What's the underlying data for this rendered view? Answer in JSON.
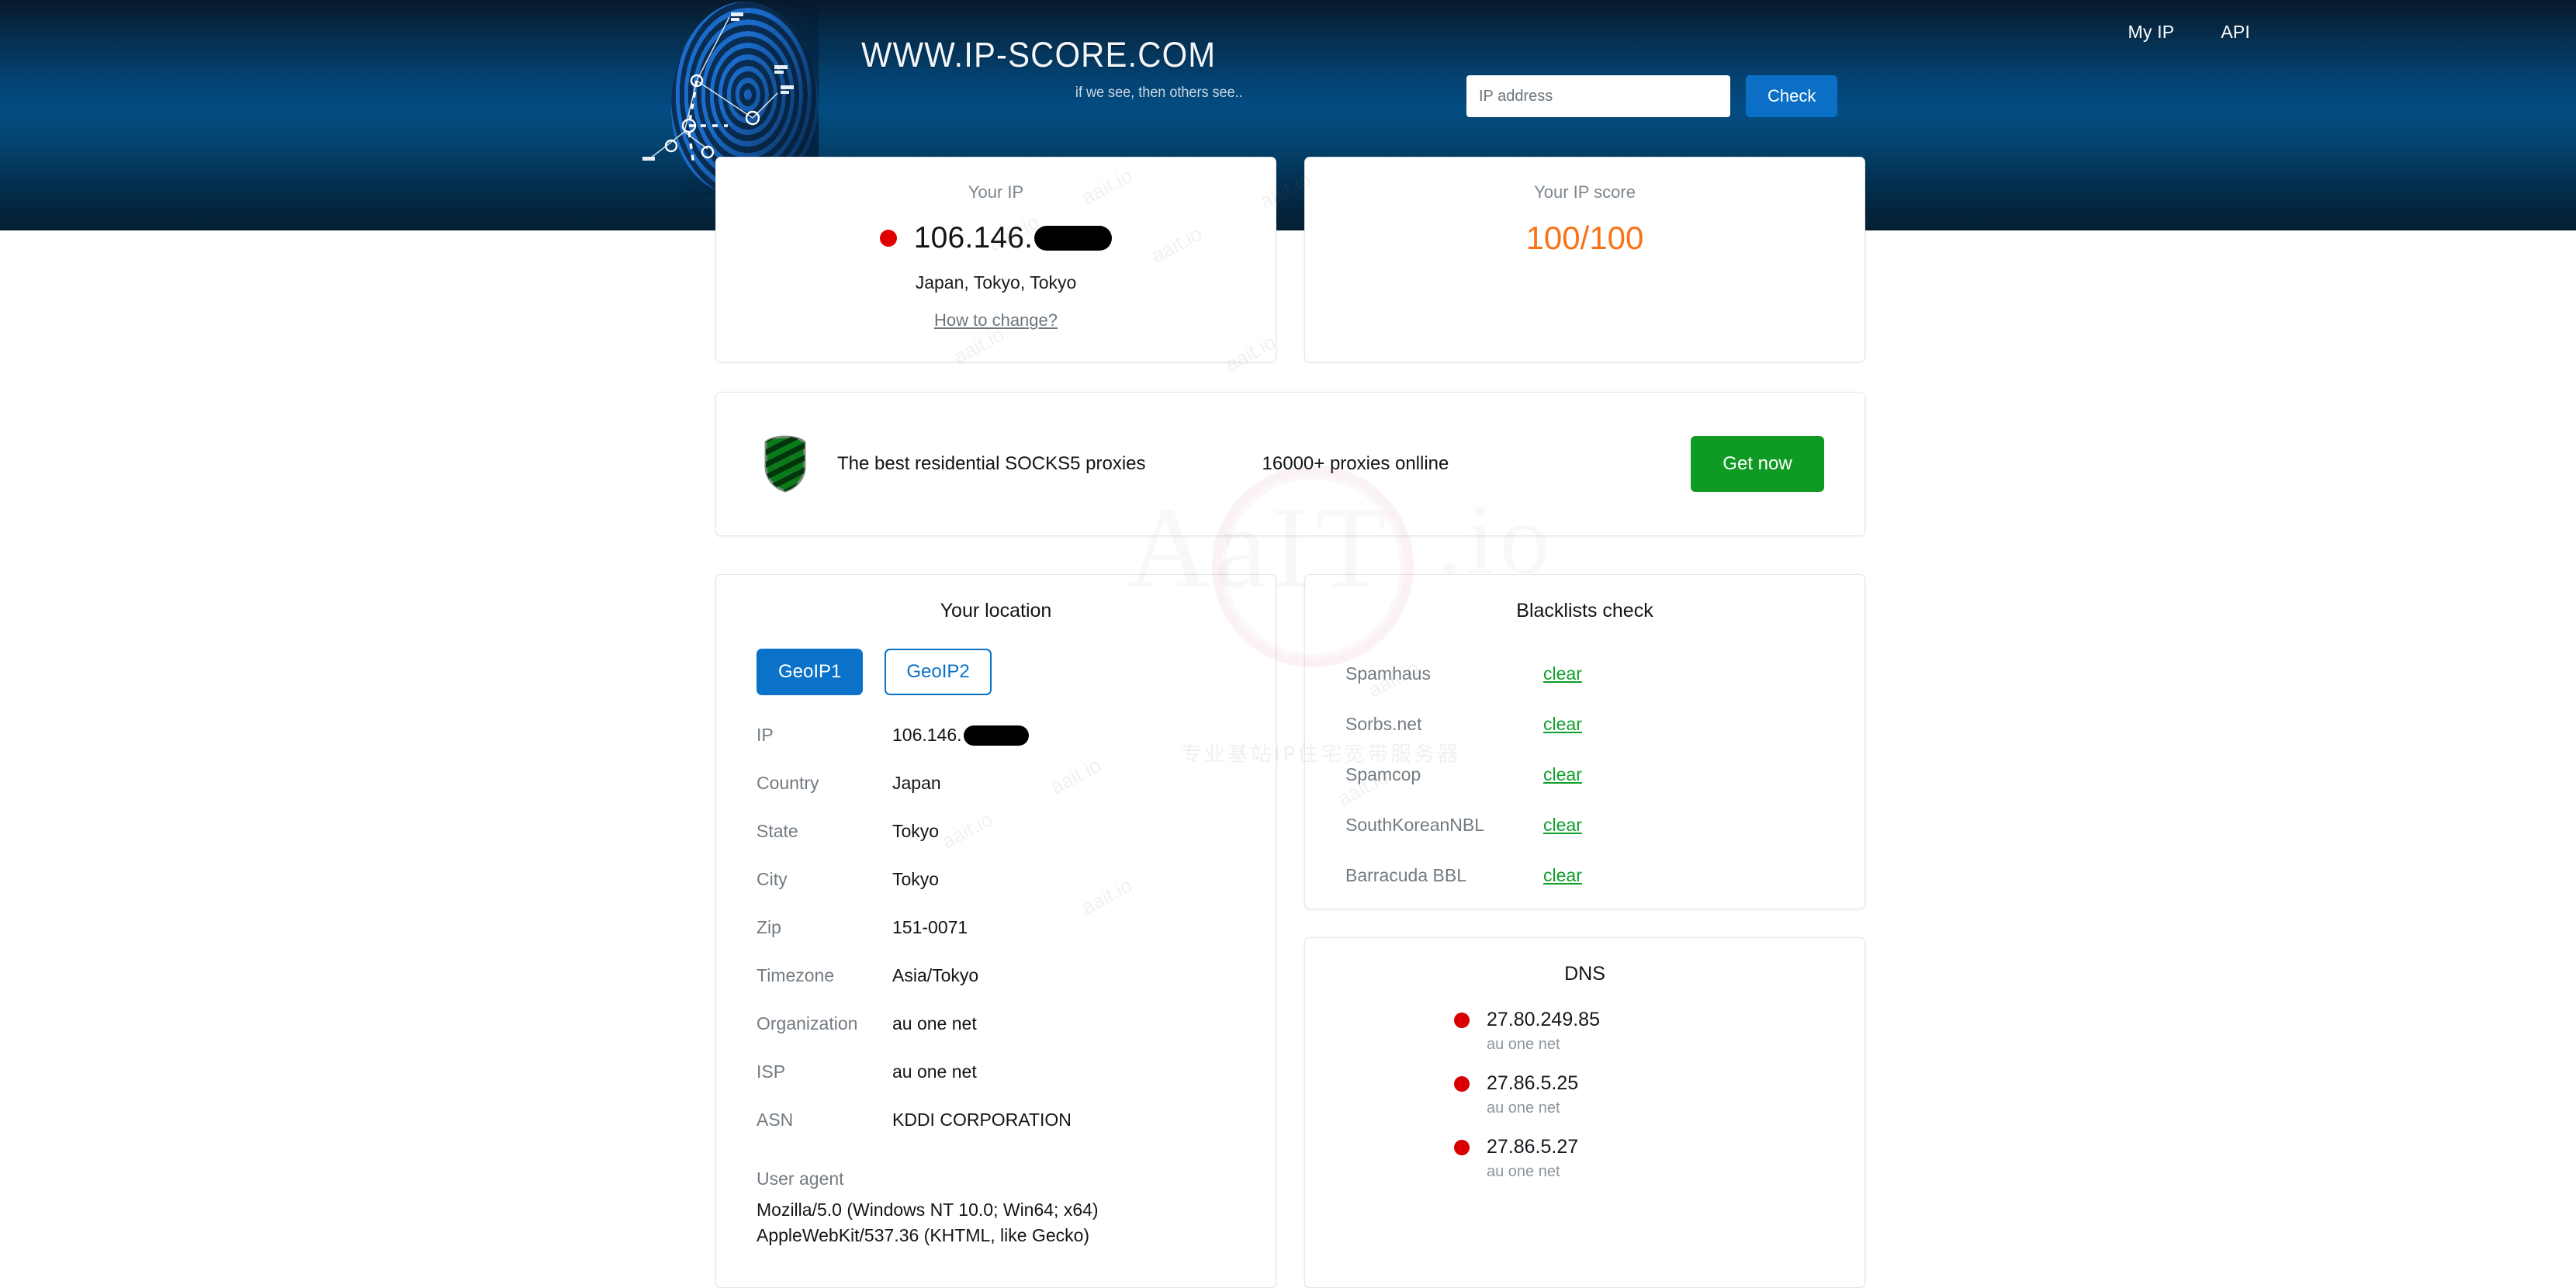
{
  "header": {
    "logo_title": "WWW.IP-SCORE.COM",
    "logo_tagline": "if we see, then others see..",
    "nav": [
      {
        "label": "My IP"
      },
      {
        "label": "API"
      }
    ],
    "search": {
      "placeholder": "IP address",
      "value": "",
      "button_label": "Check"
    }
  },
  "your_ip_card": {
    "label": "Your IP",
    "ip_visible_prefix": "106.146.",
    "ip_redacted": true,
    "location": "Japan, Tokyo, Tokyo",
    "how_to_change_label": "How to change?",
    "flag_color": "#e00000"
  },
  "ip_score_card": {
    "label": "Your IP score",
    "score": "100/100",
    "score_color": "#f97316"
  },
  "promo": {
    "icon": "green-shield-icon",
    "headline": "The best residential SOCKS5 proxies",
    "subline": "16000+ proxies onlline",
    "cta_label": "Get now",
    "cta_color": "#0f9b23"
  },
  "location_card": {
    "title": "Your location",
    "tabs": [
      {
        "label": "GeoIP1",
        "active": true
      },
      {
        "label": "GeoIP2",
        "active": false
      }
    ],
    "rows": [
      {
        "key": "IP",
        "value": "106.146.",
        "redacted": true
      },
      {
        "key": "Country",
        "value": "Japan"
      },
      {
        "key": "State",
        "value": "Tokyo"
      },
      {
        "key": "City",
        "value": "Tokyo"
      },
      {
        "key": "Zip",
        "value": "151-0071"
      },
      {
        "key": "Timezone",
        "value": "Asia/Tokyo"
      },
      {
        "key": "Organization",
        "value": "au one net"
      },
      {
        "key": "ISP",
        "value": "au one net"
      },
      {
        "key": "ASN",
        "value": "KDDI CORPORATION"
      }
    ],
    "user_agent_label": "User agent",
    "user_agent_value": "Mozilla/5.0 (Windows NT 10.0; Win64; x64) AppleWebKit/537.36 (KHTML, like Gecko)"
  },
  "blacklists_card": {
    "title": "Blacklists check",
    "status_color": "#0e9f2b",
    "rows": [
      {
        "name": "Spamhaus",
        "status": "clear"
      },
      {
        "name": "Sorbs.net",
        "status": "clear"
      },
      {
        "name": "Spamcop",
        "status": "clear"
      },
      {
        "name": "SouthKoreanNBL",
        "status": "clear"
      },
      {
        "name": "Barracuda BBL",
        "status": "clear"
      }
    ]
  },
  "dns_card": {
    "title": "DNS",
    "dot_color": "#d80000",
    "entries": [
      {
        "ip": "27.80.249.85",
        "org": "au one net"
      },
      {
        "ip": "27.86.5.25",
        "org": "au one net"
      },
      {
        "ip": "27.86.5.27",
        "org": "au one net"
      }
    ]
  },
  "watermarks": {
    "small": "aait.io",
    "big": "AaIT",
    "big_suffix": ".io",
    "chinese": "专业基站IP住宅宽带服务器"
  }
}
